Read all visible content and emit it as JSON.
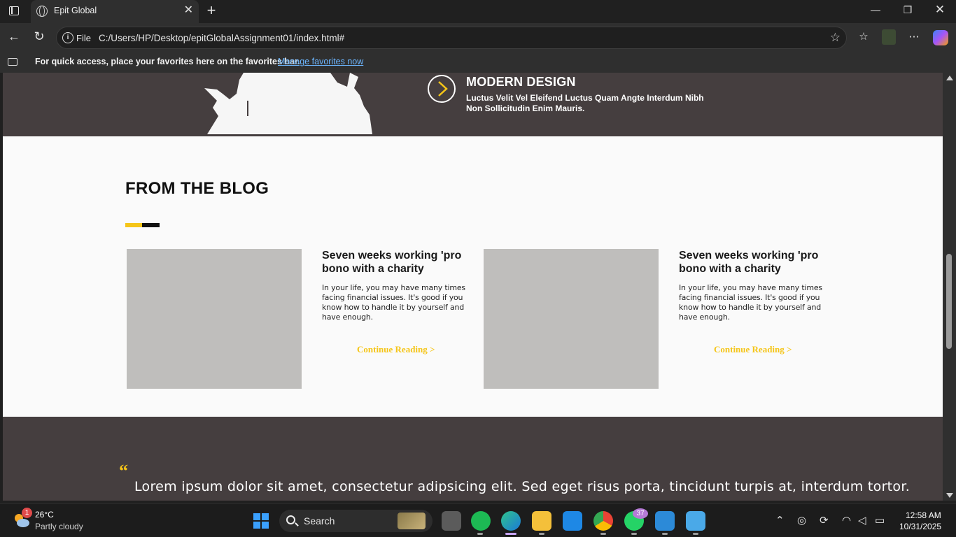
{
  "browser": {
    "tab_title": "Epit Global",
    "address_protocol": "File",
    "address_url": "C:/Users/HP/Desktop/epitGlobalAssignment01/index.html#",
    "favorites_bar_message": "For quick access, place your favorites here on the favorites bar.",
    "favorites_bar_link": "Manage favorites now"
  },
  "page": {
    "feature": {
      "title": "MODERN DESIGN",
      "description": "Luctus Velit Vel Eleifend Luctus Quam Angte Interdum Nibh Non Sollicitudin Enim Mauris."
    },
    "blog": {
      "heading": "FROM THE BLOG",
      "cards": [
        {
          "title": "Seven weeks working 'pro bono with a charity",
          "text": "In your life, you may have many times facing financial issues. It's good if you know how to handle it by yourself and have enough.",
          "link": "Continue Reading >"
        },
        {
          "title": "Seven weeks working 'pro bono with a charity",
          "text": "In your life, you may have many times facing financial issues. It's good if you know how to handle it by yourself and have enough.",
          "link": "Continue Reading >"
        }
      ]
    },
    "quote": {
      "mark": "“",
      "text": "Lorem ipsum dolor sit amet, consectetur adipsicing elit. Sed eget risus porta, tincidunt turpis at, interdum tortor."
    },
    "colors": {
      "dark_section": "#453e3f",
      "accent_yellow": "#f5c518",
      "image_placeholder": "#bfbebc"
    }
  },
  "taskbar": {
    "weather_badge": "1",
    "temperature": "26°C",
    "condition": "Partly cloudy",
    "search_label": "Search",
    "whatsapp_badge": "37",
    "time": "12:58 AM",
    "date": "10/31/2025",
    "apps": [
      "task-view-icon",
      "spotify-icon",
      "edge-icon",
      "file-explorer-icon",
      "app-icon",
      "chrome-icon",
      "whatsapp-icon",
      "vscode-icon",
      "notepad-icon"
    ]
  }
}
